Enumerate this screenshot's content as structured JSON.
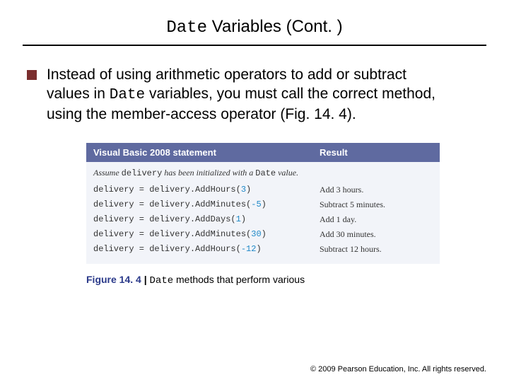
{
  "title": {
    "prefix": "Date",
    "rest": " Variables (Cont. )"
  },
  "bullet": {
    "before": "Instead of using arithmetic operators to add or subtract values in ",
    "code": "Date",
    "after": " variables, you must call the correct method, using the member-access operator (Fig. 14. 4)."
  },
  "figure": {
    "header_stmt": "Visual Basic 2008 statement",
    "header_res": "Result",
    "assume_before": "Assume ",
    "assume_code1": "delivery",
    "assume_mid": " has been initialized with a ",
    "assume_code2": "Date",
    "assume_after": " value.",
    "rows": [
      {
        "pre": "delivery = delivery.AddHours(",
        "arg": "3",
        "post": ")",
        "result": "Add 3 hours."
      },
      {
        "pre": "delivery = delivery.AddMinutes(",
        "arg": "-5",
        "post": ")",
        "result": "Subtract 5 minutes."
      },
      {
        "pre": "delivery = delivery.AddDays(",
        "arg": "1",
        "post": ")",
        "result": "Add 1 day."
      },
      {
        "pre": "delivery = delivery.AddMinutes(",
        "arg": "30",
        "post": ")",
        "result": "Add 30 minutes."
      },
      {
        "pre": "delivery = delivery.AddHours(",
        "arg": "-12",
        "post": ")",
        "result": "Subtract 12 hours."
      }
    ]
  },
  "caption": {
    "label": "Figure 14. 4",
    "pipe": " | ",
    "code": "Date",
    "rest": " methods that perform various"
  },
  "footer": "© 2009 Pearson Education, Inc. All rights reserved."
}
